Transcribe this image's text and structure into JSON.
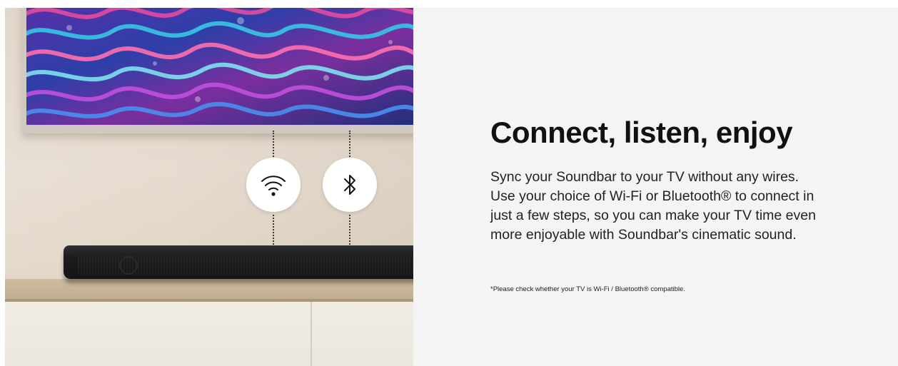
{
  "content": {
    "headline": "Connect, listen, enjoy",
    "body_lines": [
      "Sync your Soundbar to your TV without any wires.",
      "Use your choice of Wi-Fi or Bluetooth® to connect in",
      "just a few steps, so you can make your TV time even",
      "more enjoyable with Soundbar's cinematic sound."
    ],
    "disclaimer": "*Please check whether your TV is Wi-Fi / Bluetooth® compatible."
  },
  "icons": {
    "wifi": "wifi-icon",
    "bluetooth": "bluetooth-icon"
  },
  "colors": {
    "panel_background": "#f4f4f4",
    "text": "#111111"
  }
}
